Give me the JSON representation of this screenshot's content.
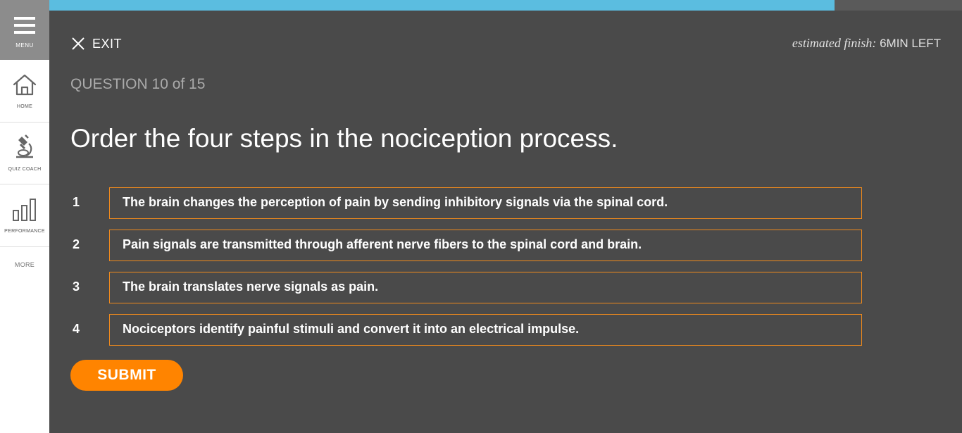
{
  "sidebar": {
    "menu_label": "MENU",
    "items": [
      {
        "label": "HOME",
        "icon": "home-icon"
      },
      {
        "label": "QUIZ COACH",
        "icon": "microscope-icon"
      },
      {
        "label": "PERFORMANCE",
        "icon": "bar-chart-icon"
      },
      {
        "label": "MORE"
      }
    ]
  },
  "progress": {
    "value": 0.86,
    "fill_color": "#5bbde0",
    "track_color": "#5a5a5a"
  },
  "header": {
    "exit_label": "EXIT",
    "estimated_label": "estimated finish:",
    "time_left": "6MIN LEFT"
  },
  "question": {
    "counter": "QUESTION 10 of 15",
    "text": "Order the four steps in the nociception process."
  },
  "answers": [
    {
      "number": "1",
      "text": "The brain changes the perception of pain by sending inhibitory signals via the spinal cord."
    },
    {
      "number": "2",
      "text": "Pain signals are transmitted through afferent nerve fibers to the spinal cord and brain."
    },
    {
      "number": "3",
      "text": "The brain translates nerve signals as pain."
    },
    {
      "number": "4",
      "text": "Nociceptors identify painful stimuli and convert it into an electrical impulse."
    }
  ],
  "submit_label": "SUBMIT",
  "colors": {
    "accent": "#ff8400",
    "answer_border": "#f08a1c",
    "background": "#4a4a4a",
    "sidebar": "#ffffff",
    "menu": "#8c8c8c"
  }
}
